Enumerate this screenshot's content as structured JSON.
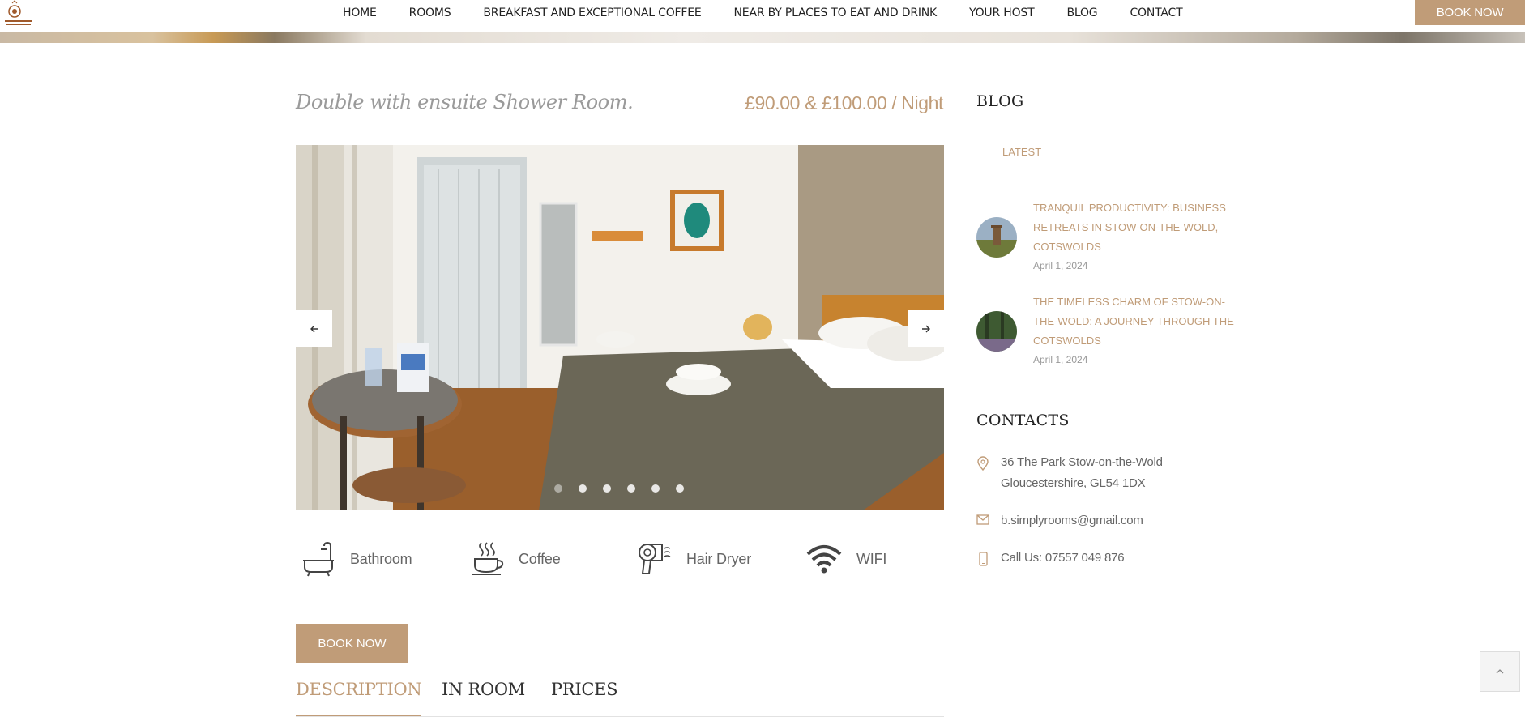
{
  "header": {
    "nav": [
      {
        "label": "HOME"
      },
      {
        "label": "ROOMS"
      },
      {
        "label": "BREAKFAST AND EXCEPTIONAL COFFEE"
      },
      {
        "label": "NEAR BY PLACES TO EAT AND DRINK"
      },
      {
        "label": "YOUR HOST"
      },
      {
        "label": "BLOG"
      },
      {
        "label": "CONTACT"
      }
    ],
    "book_now_label": "BOOK NOW"
  },
  "room": {
    "title": "Double with ensuite Shower Room.",
    "price": "£90.00 & £100.00 / Night",
    "slider": {
      "prev_icon": "arrow-left-icon",
      "next_icon": "arrow-right-icon",
      "dot_count": 6,
      "active_dot": 1
    },
    "amenities": [
      {
        "label": "Bathroom",
        "icon": "bathtub-icon"
      },
      {
        "label": "Coffee",
        "icon": "coffee-cup-icon"
      },
      {
        "label": "Hair Dryer",
        "icon": "hair-dryer-icon"
      },
      {
        "label": "WIFI",
        "icon": "wifi-icon"
      }
    ],
    "book_now_label": "BOOK NOW",
    "tabs": [
      {
        "label": "DESCRIPTION",
        "active": true
      },
      {
        "label": "IN ROOM",
        "active": false
      },
      {
        "label": "PRICES",
        "active": false
      }
    ]
  },
  "sidebar": {
    "blog_heading": "BLOG",
    "latest_label": "LATEST",
    "posts": [
      {
        "title": "TRANQUIL PRODUCTIVITY: BUSINESS RETREATS IN STOW-ON-THE-WOLD, COTSWOLDS",
        "date": "April 1, 2024"
      },
      {
        "title": "THE TIMELESS CHARM OF STOW-ON-THE-WOLD: A JOURNEY THROUGH THE COTSWOLDS",
        "date": "April 1, 2024"
      }
    ],
    "contacts_heading": "CONTACTS",
    "address_line1": "36 The Park Stow-on-the-Wold",
    "address_line2": "Gloucestershire, GL54 1DX",
    "email": "b.simplyrooms@gmail.com",
    "phone": "Call Us: 07557 049 876"
  },
  "colors": {
    "accent": "#c09c78",
    "text": "#666666",
    "heading": "#222222"
  }
}
